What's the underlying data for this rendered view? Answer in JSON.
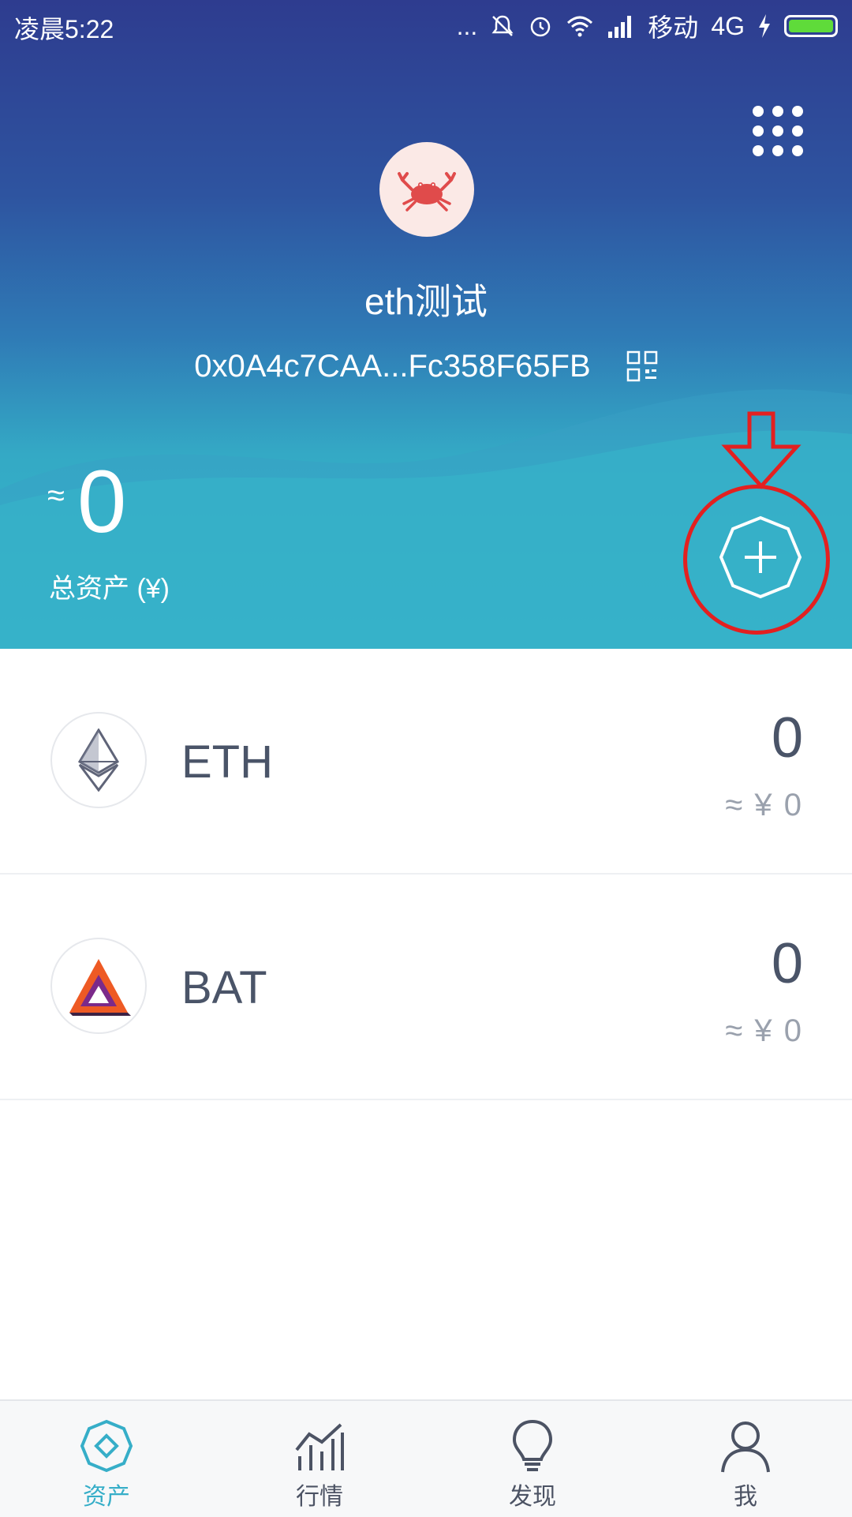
{
  "status_bar": {
    "time": "凌晨5:22",
    "dots": "...",
    "carrier": "移动",
    "network": "4G"
  },
  "wallet": {
    "name": "eth测试",
    "address": "0x0A4c7CAA...Fc358F65FB"
  },
  "total_assets": {
    "approx_symbol": "≈",
    "value": "0",
    "label": "总资产 (¥)"
  },
  "tokens": [
    {
      "symbol": "ETH",
      "amount": "0",
      "fiat": "≈ ¥ 0",
      "icon": "ethereum-icon"
    },
    {
      "symbol": "BAT",
      "amount": "0",
      "fiat": "≈ ¥ 0",
      "icon": "bat-icon"
    }
  ],
  "tabs": [
    {
      "label": "资产",
      "icon": "assets-icon",
      "active": true
    },
    {
      "label": "行情",
      "icon": "market-chart-icon",
      "active": false
    },
    {
      "label": "发现",
      "icon": "lightbulb-icon",
      "active": false
    },
    {
      "label": "我",
      "icon": "person-icon",
      "active": false
    }
  ],
  "colors": {
    "header_top": "#2e3c8f",
    "header_bottom": "#36bac9",
    "accent": "#36aec8",
    "annotation": "#e32020"
  }
}
